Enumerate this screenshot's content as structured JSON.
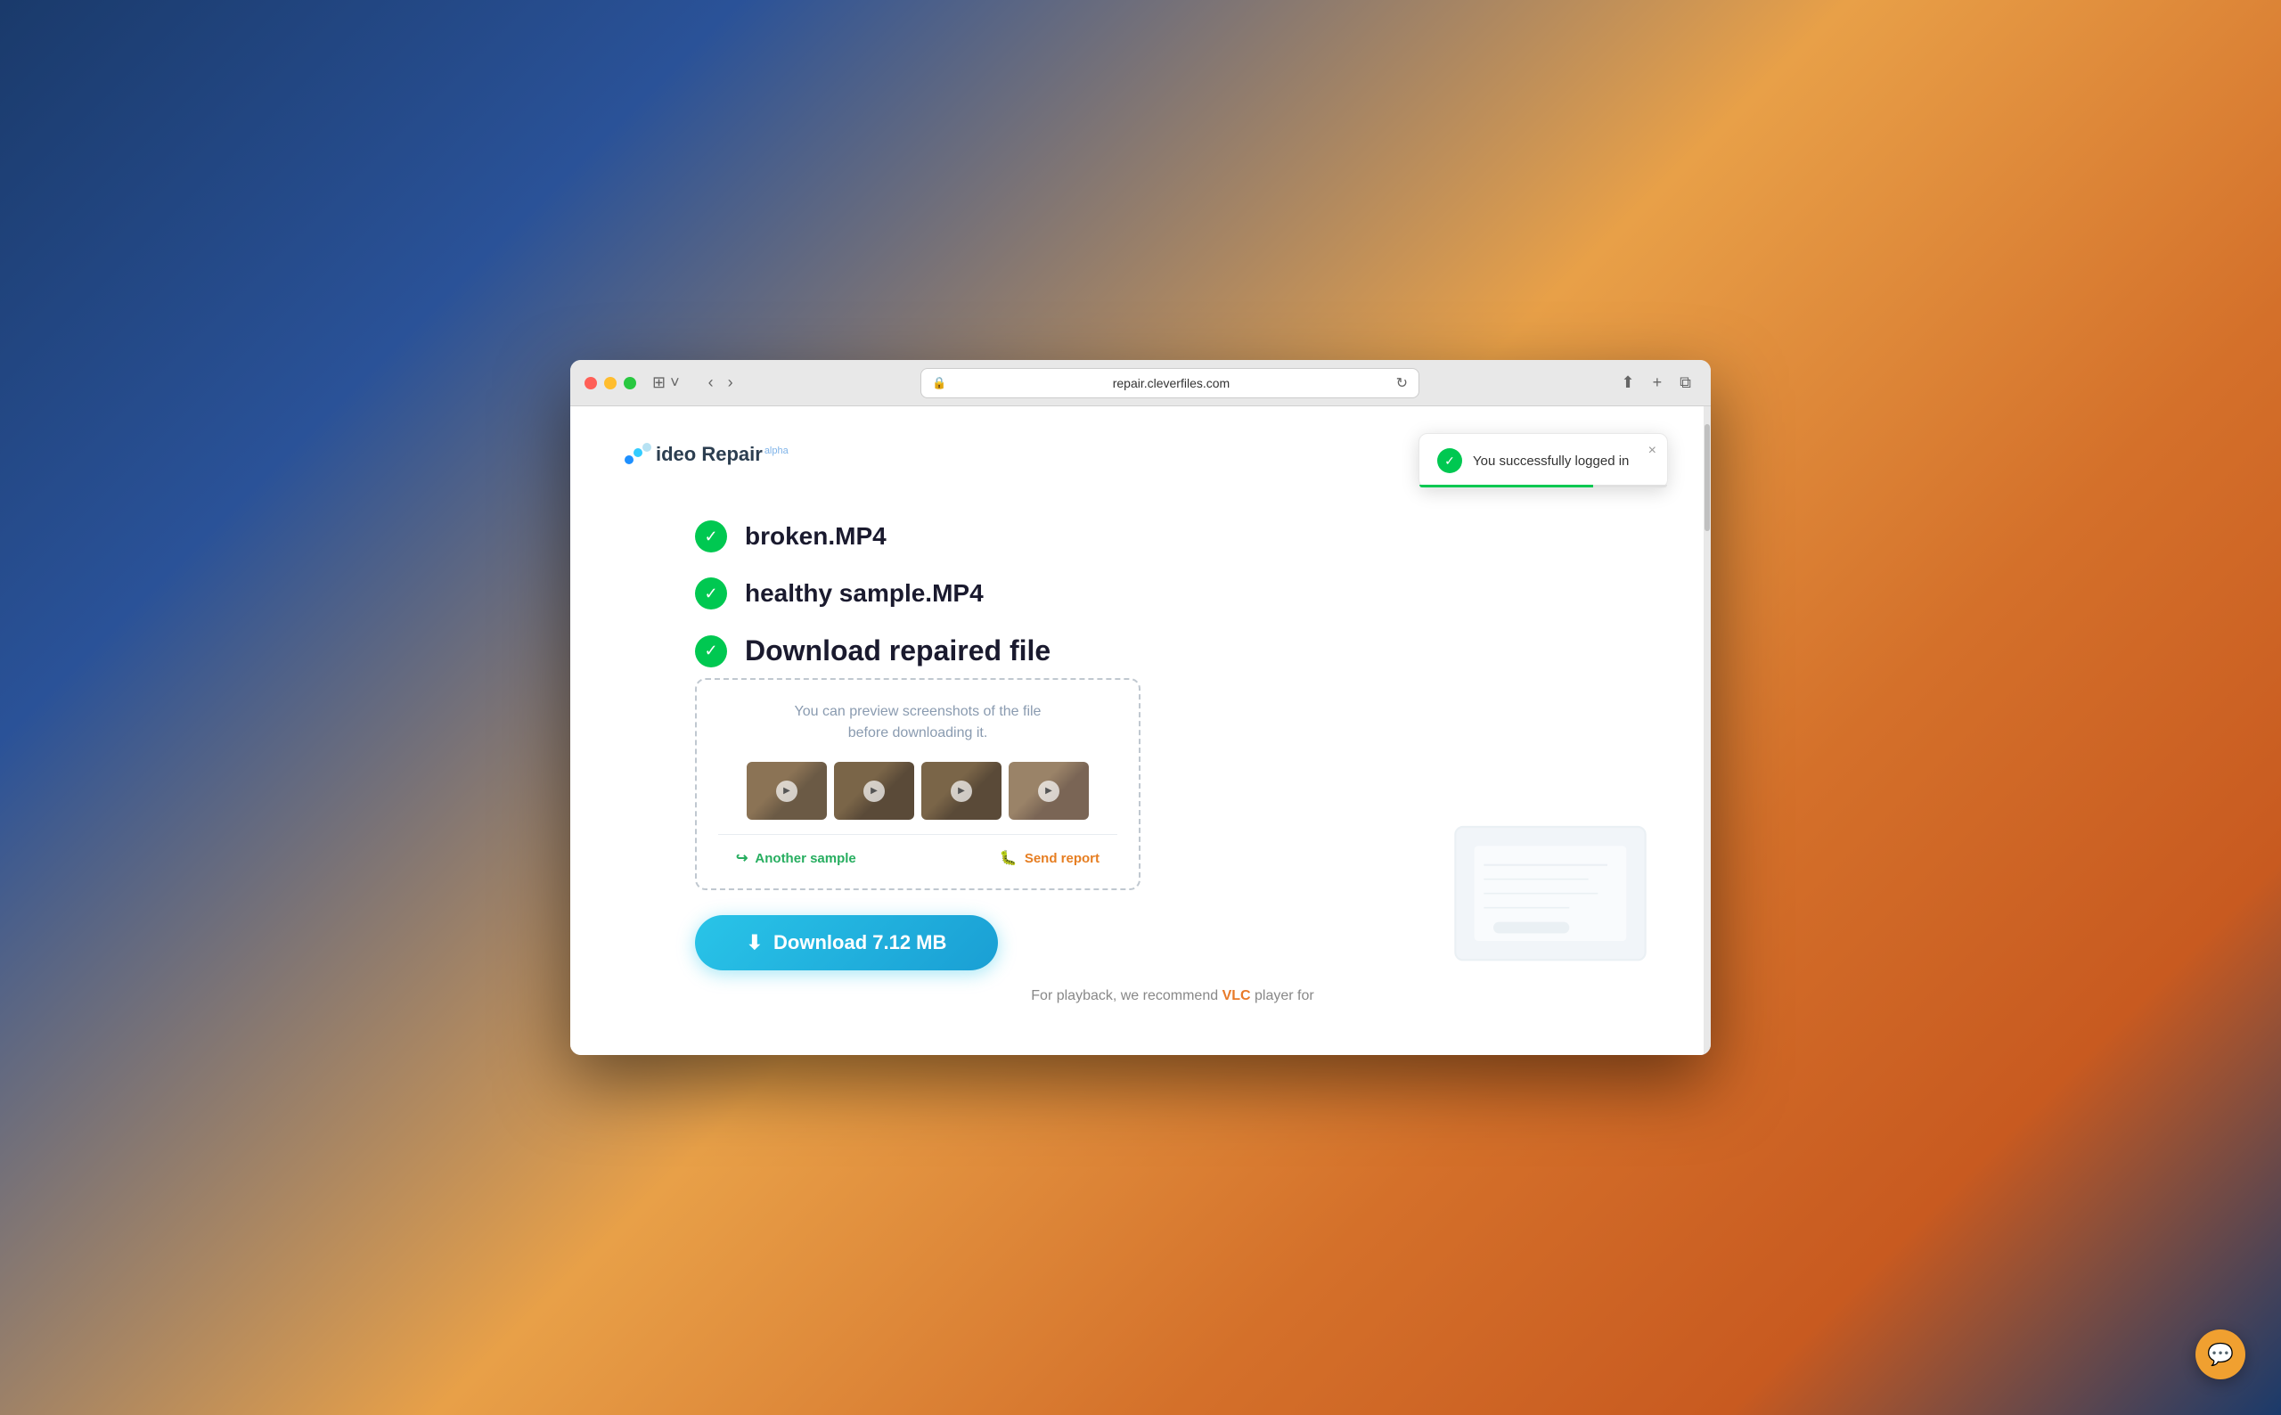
{
  "browser": {
    "url": "repair.cleverfiles.com",
    "title": "Video Repair"
  },
  "logo": {
    "text": "ideo Repair",
    "alpha_badge": "alpha"
  },
  "toast": {
    "message": "You successfully logged in",
    "close_label": "×"
  },
  "steps": [
    {
      "label": "broken.MP4",
      "done": true
    },
    {
      "label": "healthy sample.MP4",
      "done": true
    },
    {
      "label": "Download repaired file",
      "done": true,
      "active": true
    }
  ],
  "preview": {
    "description": "You can preview screenshots of the file\nbefore downloading it.",
    "thumbnails": [
      {
        "alt": "thumbnail-1"
      },
      {
        "alt": "thumbnail-2"
      },
      {
        "alt": "thumbnail-3"
      },
      {
        "alt": "thumbnail-4"
      }
    ],
    "action_another_sample": "Another sample",
    "action_send_report": "Send report"
  },
  "download_button": {
    "label": "Download 7.12 MB"
  },
  "playback_text": {
    "prefix": "For playback, we recommend ",
    "vlc": "VLC",
    "suffix": " player for"
  },
  "chat_button": {
    "icon": "💬"
  }
}
